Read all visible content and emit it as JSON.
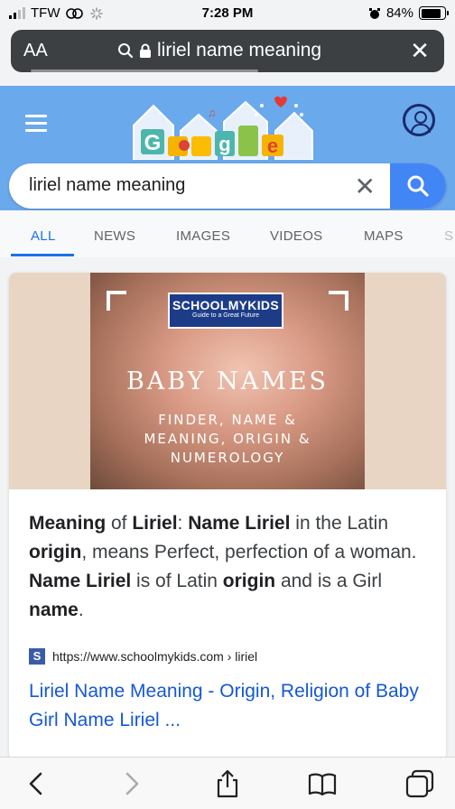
{
  "status": {
    "carrier": "TFW",
    "time": "7:28 PM",
    "battery": "84%",
    "battery_level": 0.84
  },
  "address_bar": {
    "text_size_label": "AA",
    "url_text": "liriel name meaning"
  },
  "search": {
    "query": "liriel name meaning"
  },
  "tabs": [
    {
      "label": "ALL",
      "active": true
    },
    {
      "label": "NEWS"
    },
    {
      "label": "IMAGES"
    },
    {
      "label": "VIDEOS"
    },
    {
      "label": "MAPS"
    },
    {
      "label": "S"
    }
  ],
  "result": {
    "image": {
      "brand": "SCHOOLMYKIDS",
      "tagline": "Guide to a Great Future",
      "title": "BABY NAMES",
      "subtitle_lines": [
        "FINDER, NAME &",
        "MEANING, ORIGIN &",
        "NUMEROLOGY"
      ]
    },
    "snippet": [
      {
        "t": "Meaning",
        "b": true
      },
      {
        "t": " of "
      },
      {
        "t": "Liriel",
        "b": true
      },
      {
        "t": ": "
      },
      {
        "t": "Name Liriel",
        "b": true
      },
      {
        "t": " in the Latin "
      },
      {
        "t": "origin",
        "b": true
      },
      {
        "t": ", means Perfect, perfection of a woman. "
      },
      {
        "t": "Name Liriel",
        "b": true
      },
      {
        "t": " is of Latin "
      },
      {
        "t": "origin",
        "b": true
      },
      {
        "t": " and is a Girl "
      },
      {
        "t": "name",
        "b": true
      },
      {
        "t": "."
      }
    ],
    "favicon_letter": "S",
    "source_url": "https://www.schoolmykids.com › liriel",
    "title": "Liriel Name Meaning - Origin, Religion of Baby Girl Name Liriel ..."
  },
  "colors": {
    "google_header": "#6aa9ec",
    "accent": "#1a73e8",
    "link": "#1558d6"
  },
  "icons": {
    "address_left": [
      "search-icon",
      "lock-icon"
    ],
    "toolbar": [
      "back-icon",
      "forward-icon",
      "share-icon",
      "bookmarks-icon",
      "tabs-icon"
    ]
  }
}
